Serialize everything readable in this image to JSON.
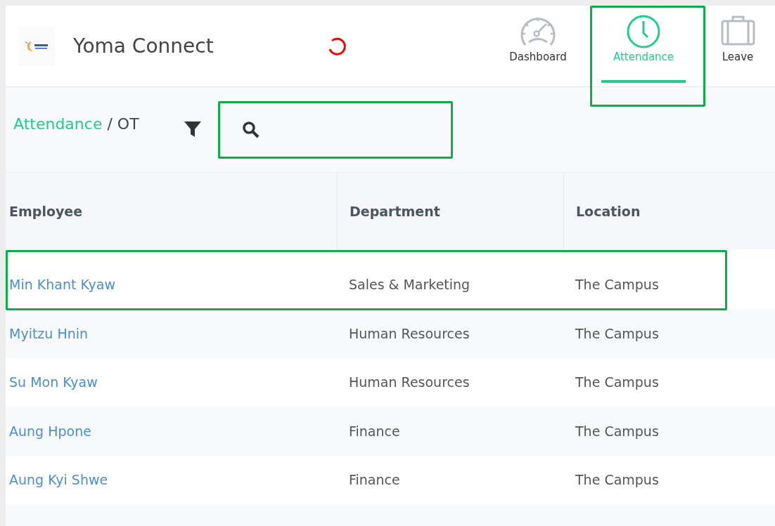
{
  "header": {
    "title": "Yoma Connect",
    "loading": true
  },
  "nav": [
    {
      "label": "Dashboard",
      "kind": "gauge",
      "selected": false
    },
    {
      "label": "Attendance",
      "kind": "clock",
      "selected": true
    },
    {
      "label": "Leave",
      "kind": "case",
      "selected": false
    }
  ],
  "breadcrumb": {
    "link": "Attendance",
    "separator": "/",
    "current": "OT"
  },
  "table": {
    "columns": [
      "Employee",
      "Department",
      "Location"
    ],
    "rows": [
      {
        "employee": "Min Khant Kyaw",
        "department": "Sales & Marketing",
        "location": "The Campus"
      },
      {
        "employee": "Myitzu Hnin",
        "department": "Human Resources",
        "location": "The Campus"
      },
      {
        "employee": "Su Mon Kyaw",
        "department": "Human Resources",
        "location": "The Campus"
      },
      {
        "employee": "Aung Hpone",
        "department": "Finance",
        "location": "The Campus"
      },
      {
        "employee": "Aung Kyi Shwe",
        "department": "Finance",
        "location": "The Campus"
      }
    ]
  }
}
